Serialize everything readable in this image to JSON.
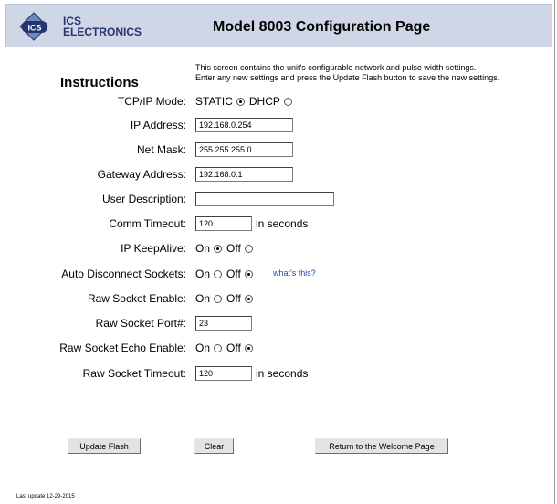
{
  "header": {
    "logo_badge": "ICS",
    "logo_line1": "ICS",
    "logo_line2": "ELECTRONICS",
    "title": "Model 8003 Configuration Page"
  },
  "instructions": {
    "title": "Instructions",
    "line1": "This screen contains the unit's configurable network and pulse width settings.",
    "line2": "Enter any new settings and press the Update Flash button to save the new settings."
  },
  "form": {
    "tcpip_mode": {
      "label": "TCP/IP Mode:",
      "static": "STATIC",
      "dhcp": "DHCP",
      "selected": "STATIC"
    },
    "ip_address": {
      "label": "IP Address:",
      "value": "192.168.0.254"
    },
    "net_mask": {
      "label": "Net Mask:",
      "value": "255.255.255.0"
    },
    "gateway": {
      "label": "Gateway Address:",
      "value": "192.168.0.1"
    },
    "user_description": {
      "label": "User Description:",
      "value": ""
    },
    "comm_timeout": {
      "label": "Comm Timeout:",
      "value": "120",
      "unit": "in seconds"
    },
    "ip_keepalive": {
      "label": "IP KeepAlive:",
      "on": "On",
      "off": "Off",
      "selected": "On"
    },
    "auto_disconnect": {
      "label": "Auto Disconnect Sockets:",
      "on": "On",
      "off": "Off",
      "selected": "Off",
      "help_link": "what's this?"
    },
    "raw_socket_enable": {
      "label": "Raw Socket Enable:",
      "on": "On",
      "off": "Off",
      "selected": "Off"
    },
    "raw_socket_port": {
      "label": "Raw Socket Port#:",
      "value": "23"
    },
    "raw_socket_echo": {
      "label": "Raw Socket Echo Enable:",
      "on": "On",
      "off": "Off",
      "selected": "Off"
    },
    "raw_socket_timeout": {
      "label": "Raw Socket Timeout:",
      "value": "120",
      "unit": "in seconds"
    }
  },
  "buttons": {
    "update_flash": "Update Flash",
    "clear": "Clear",
    "return_welcome": "Return to the Welcome Page"
  },
  "footer": {
    "last_update": "Last update 12-29-2015"
  },
  "colors": {
    "header_bg": "#cfd6e6",
    "brand_blue": "#24356e",
    "link_blue": "#2a42a0"
  }
}
